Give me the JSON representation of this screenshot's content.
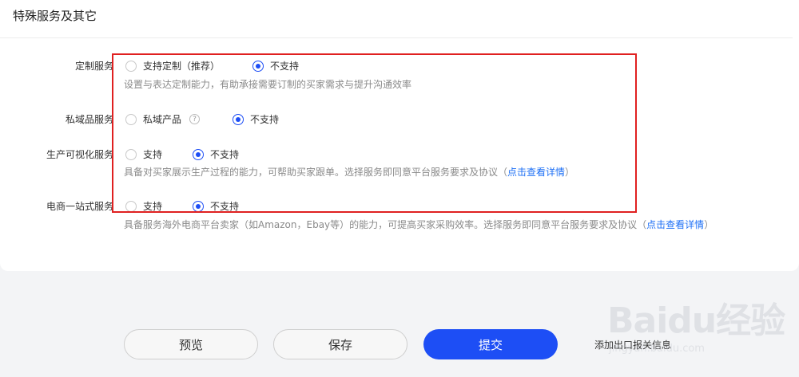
{
  "section": {
    "title": "特殊服务及其它"
  },
  "rows": {
    "custom": {
      "label": "定制服务",
      "option_yes": "支持定制（推荐）",
      "option_no": "不支持",
      "selected": "no",
      "description": "设置与表达定制能力，有助承接需要订制的买家需求与提升沟通效率"
    },
    "private": {
      "label": "私域品服务",
      "option_yes": "私域产品",
      "option_no": "不支持",
      "selected": "no",
      "help_glyph": "?"
    },
    "visual": {
      "label": "生产可视化服务",
      "option_yes": "支持",
      "option_no": "不支持",
      "selected": "no",
      "description": "具备对买家展示生产过程的能力，可帮助买家跟单。选择服务即同意平台服务要求及协议（",
      "link": "点击查看详情",
      "description_end": "）"
    },
    "ecommerce": {
      "label": "电商一站式服务",
      "option_yes": "支持",
      "option_no": "不支持",
      "selected": "no",
      "description": "具备服务海外电商平台卖家（如Amazon，Ebay等）的能力，可提高买家采购效率。选择服务即同意平台服务要求及协议（",
      "link": "点击查看详情",
      "description_end": "）"
    }
  },
  "actions": {
    "preview": "预览",
    "save": "保存",
    "submit": "提交",
    "extra": "添加出口报关信息"
  },
  "watermark": {
    "logo": "Baidu经验",
    "url": "jingyan.baidu.com"
  },
  "colors": {
    "primary": "#1d4ef5",
    "link": "#1d6ff5",
    "highlight_border": "#e02020"
  }
}
